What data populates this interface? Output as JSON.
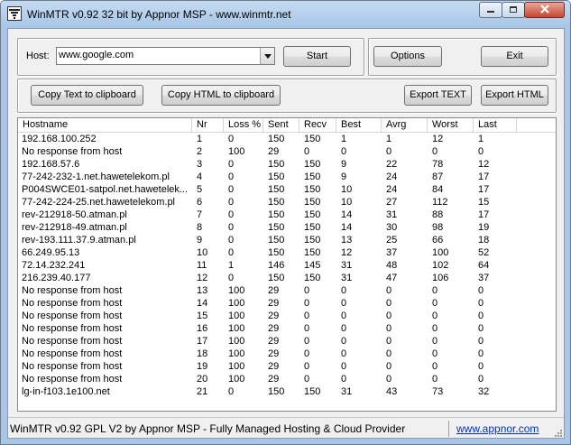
{
  "window": {
    "title": "WinMTR v0.92 32 bit by Appnor MSP - www.winmtr.net"
  },
  "host": {
    "label": "Host:",
    "value": "www.google.com"
  },
  "buttons": {
    "start": "Start",
    "options": "Options",
    "exit": "Exit",
    "copy_text": "Copy Text to clipboard",
    "copy_html": "Copy HTML to clipboard",
    "export_text": "Export TEXT",
    "export_html": "Export HTML"
  },
  "table": {
    "columns": [
      "Hostname",
      "Nr",
      "Loss %",
      "Sent",
      "Recv",
      "Best",
      "Avrg",
      "Worst",
      "Last"
    ],
    "rows": [
      [
        "192.168.100.252",
        "1",
        "0",
        "150",
        "150",
        "1",
        "1",
        "12",
        "1"
      ],
      [
        "No response from host",
        "2",
        "100",
        "29",
        "0",
        "0",
        "0",
        "0",
        "0"
      ],
      [
        "192.168.57.6",
        "3",
        "0",
        "150",
        "150",
        "9",
        "22",
        "78",
        "12"
      ],
      [
        "77-242-232-1.net.hawetelekom.pl",
        "4",
        "0",
        "150",
        "150",
        "9",
        "24",
        "87",
        "17"
      ],
      [
        "P004SWCE01-satpol.net.hawetelek...",
        "5",
        "0",
        "150",
        "150",
        "10",
        "24",
        "84",
        "17"
      ],
      [
        "77-242-224-25.net.hawetelekom.pl",
        "6",
        "0",
        "150",
        "150",
        "10",
        "27",
        "112",
        "15"
      ],
      [
        "rev-212918-50.atman.pl",
        "7",
        "0",
        "150",
        "150",
        "14",
        "31",
        "88",
        "17"
      ],
      [
        "rev-212918-49.atman.pl",
        "8",
        "0",
        "150",
        "150",
        "14",
        "30",
        "98",
        "19"
      ],
      [
        "rev-193.111.37.9.atman.pl",
        "9",
        "0",
        "150",
        "150",
        "13",
        "25",
        "66",
        "18"
      ],
      [
        "66.249.95.13",
        "10",
        "0",
        "150",
        "150",
        "12",
        "37",
        "100",
        "52"
      ],
      [
        "72.14.232.241",
        "11",
        "1",
        "146",
        "145",
        "31",
        "48",
        "102",
        "64"
      ],
      [
        "216.239.40.177",
        "12",
        "0",
        "150",
        "150",
        "31",
        "47",
        "106",
        "37"
      ],
      [
        "No response from host",
        "13",
        "100",
        "29",
        "0",
        "0",
        "0",
        "0",
        "0"
      ],
      [
        "No response from host",
        "14",
        "100",
        "29",
        "0",
        "0",
        "0",
        "0",
        "0"
      ],
      [
        "No response from host",
        "15",
        "100",
        "29",
        "0",
        "0",
        "0",
        "0",
        "0"
      ],
      [
        "No response from host",
        "16",
        "100",
        "29",
        "0",
        "0",
        "0",
        "0",
        "0"
      ],
      [
        "No response from host",
        "17",
        "100",
        "29",
        "0",
        "0",
        "0",
        "0",
        "0"
      ],
      [
        "No response from host",
        "18",
        "100",
        "29",
        "0",
        "0",
        "0",
        "0",
        "0"
      ],
      [
        "No response from host",
        "19",
        "100",
        "29",
        "0",
        "0",
        "0",
        "0",
        "0"
      ],
      [
        "No response from host",
        "20",
        "100",
        "29",
        "0",
        "0",
        "0",
        "0",
        "0"
      ],
      [
        "lg-in-f103.1e100.net",
        "21",
        "0",
        "150",
        "150",
        "31",
        "43",
        "73",
        "32"
      ]
    ]
  },
  "status": {
    "text": "WinMTR v0.92 GPL V2 by Appnor MSP - Fully Managed Hosting & Cloud Provider",
    "link": "www.appnor.com"
  }
}
